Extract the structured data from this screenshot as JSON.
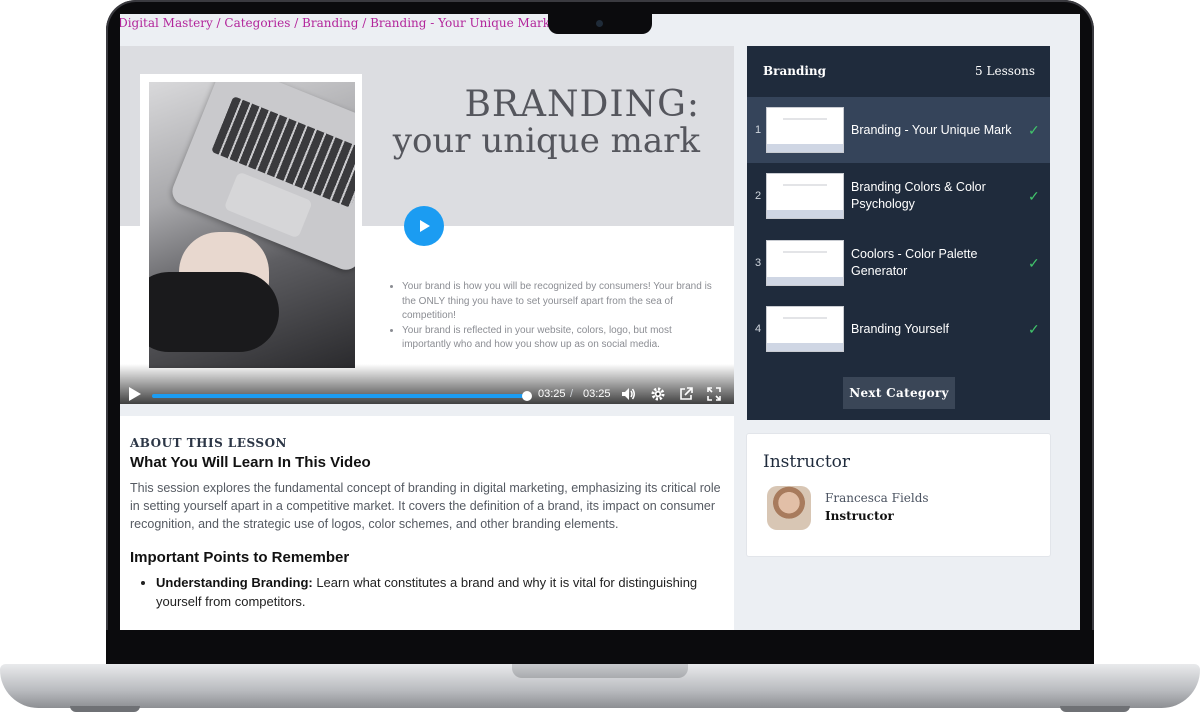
{
  "breadcrumb": "Passive Digital Mastery / Categories / Branding / Branding - Your Unique Mark",
  "video": {
    "slide_title_line1": "BRANDING:",
    "slide_title_line2": "your unique mark",
    "slide_bullets": [
      "Your brand is how you will be recognized by consumers! Your brand is the ONLY thing you have to set yourself apart from the sea of competition!",
      "Your brand is reflected in your website, colors, logo, but most importantly who and how you show up as on social media."
    ],
    "current_time": "03:25",
    "separator": "/",
    "duration": "03:25",
    "progress_percent": 100
  },
  "lesson": {
    "eyebrow": "ABOUT THIS LESSON",
    "heading": "What You Will Learn In This Video",
    "description": "This session explores the fundamental concept of branding in digital marketing, emphasizing its critical role in setting yourself apart in a competitive market. It covers the definition of a brand, its impact on consumer recognition, and the strategic use of logos, color schemes, and other branding elements.",
    "points_heading": "Important Points to Remember",
    "points": [
      {
        "label": "Understanding Branding:",
        "text": " Learn what constitutes a brand and why it is vital for distinguishing yourself from competitors."
      }
    ]
  },
  "panel": {
    "title": "Branding",
    "count": "5 Lessons",
    "lessons": [
      {
        "num": "1",
        "title": "Branding - Your Unique Mark",
        "status": "completed"
      },
      {
        "num": "2",
        "title": "Branding Colors & Color Psychology",
        "status": "completed"
      },
      {
        "num": "3",
        "title": "Coolors - Color Palette Generator",
        "status": "completed"
      },
      {
        "num": "4",
        "title": "Branding Yourself",
        "status": "completed"
      }
    ],
    "next_label": "Next Category"
  },
  "instructor": {
    "heading": "Instructor",
    "name": "Francesca Fields",
    "role": "Instructor"
  },
  "colors": {
    "panel_bg": "#1f2b3c",
    "accent_blue": "#1b9cf2",
    "breadcrumb": "#b2259b",
    "check": "#41c46b"
  }
}
